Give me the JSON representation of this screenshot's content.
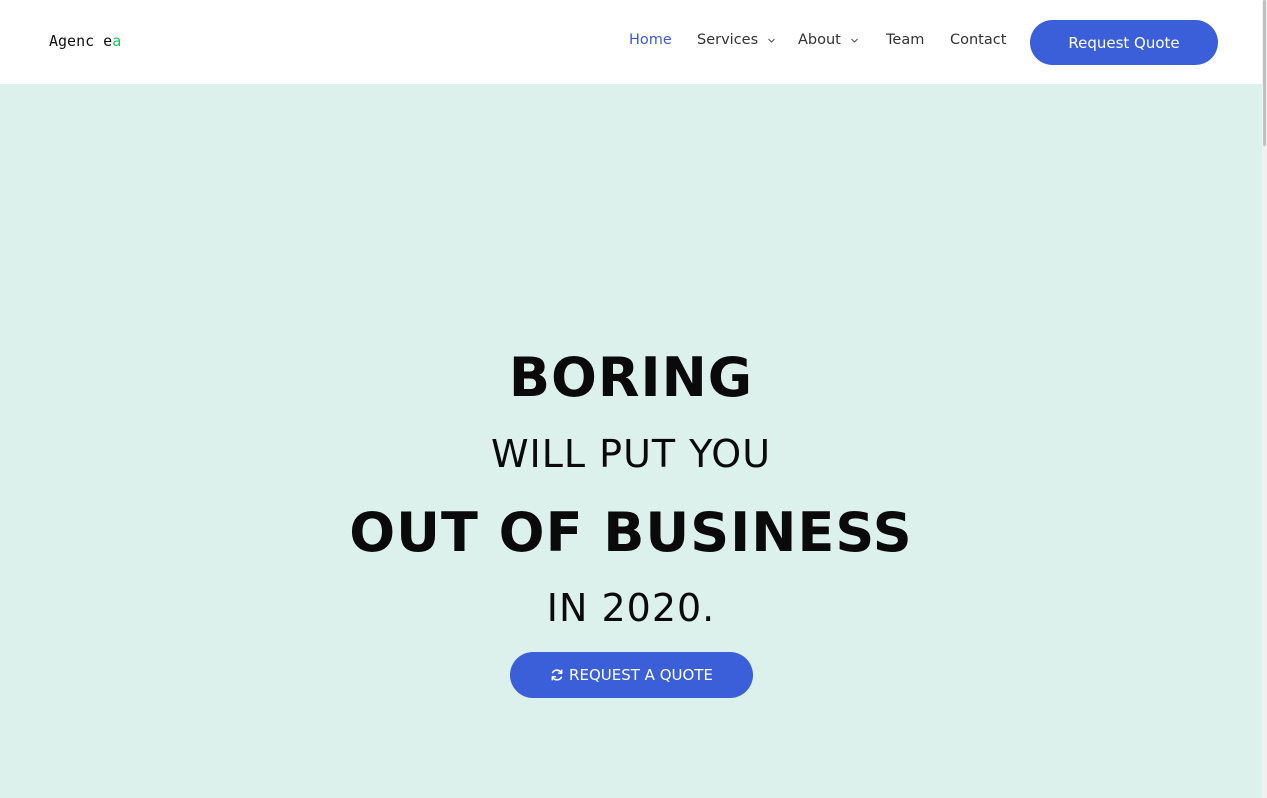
{
  "brand": {
    "logo_main": "Agenc e",
    "logo_accent": "a",
    "accent_color": "#22c55e"
  },
  "nav": {
    "items": [
      {
        "label": "Home",
        "active": true,
        "has_dropdown": false
      },
      {
        "label": "Services",
        "active": false,
        "has_dropdown": true
      },
      {
        "label": "About",
        "active": false,
        "has_dropdown": true
      },
      {
        "label": "Team",
        "active": false,
        "has_dropdown": false
      },
      {
        "label": "Contact",
        "active": false,
        "has_dropdown": false
      }
    ],
    "cta_label": "Request Quote"
  },
  "hero": {
    "line1": "BORING",
    "line2": "WILL PUT YOU",
    "line3": "OUT OF BUSINESS",
    "line4": "IN 2020.",
    "cta_label": "REQUEST A QUOTE",
    "cta_icon": "refresh-icon",
    "background_color": "#dcf1eb"
  },
  "colors": {
    "primary": "#3b5fd9",
    "nav_active": "#3b5bdb",
    "text": "#0a0a0a"
  }
}
